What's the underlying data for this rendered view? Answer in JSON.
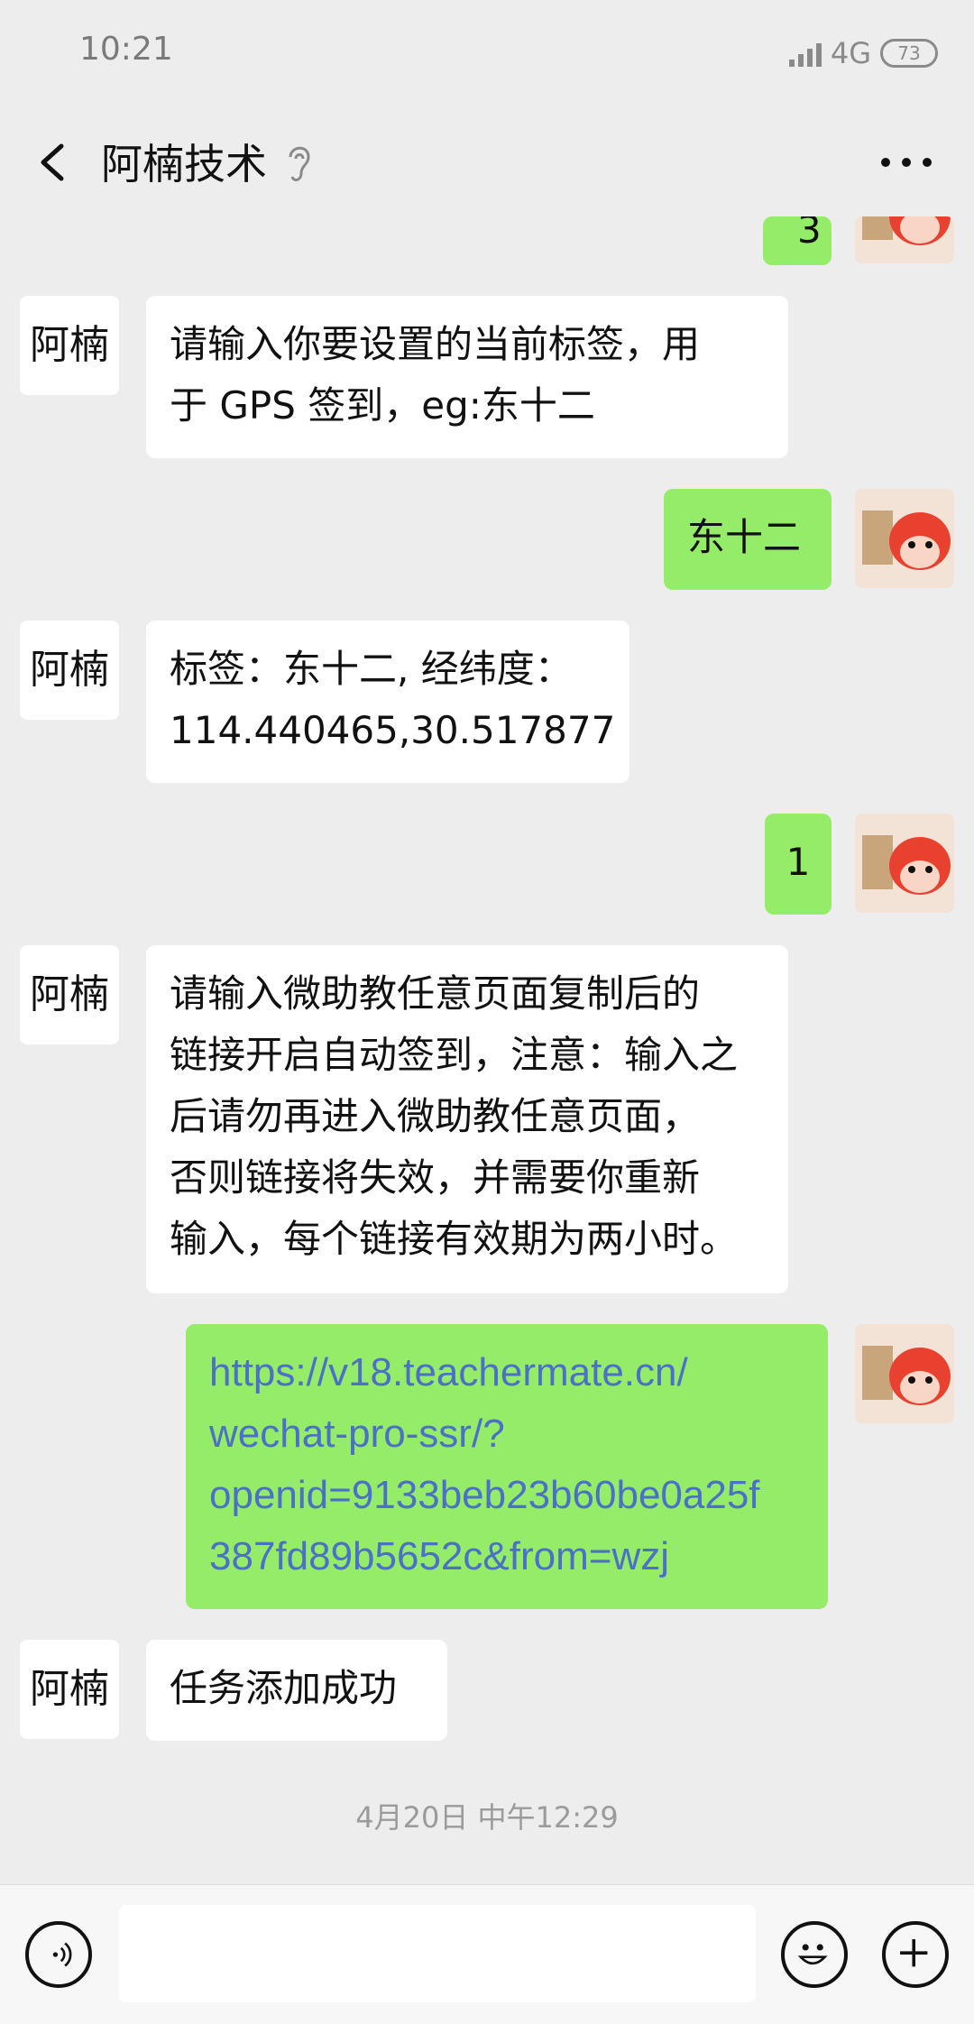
{
  "status": {
    "time": "10:21",
    "network": "4G",
    "battery": "73"
  },
  "header": {
    "title": "阿楠技术"
  },
  "messages": {
    "partial_right": "3",
    "m1": "请输入你要设置的当前标签，用\n于 GPS 签到，eg:东十二",
    "m2": "东十二",
    "m3": "标签：东十二, 经纬度：\n114.440465,30.517877",
    "m4": "1",
    "m5": "请输入微助教任意页面复制后的\n链接开启自动签到，注意：输入之\n后请勿再进入微助教任意页面，\n否则链接将失效，并需要你重新\n输入，每个链接有效期为两小时。",
    "m6": "https://v18.teachermate.cn/\nwechat-pro-ssr/?\nopenid=9133beb23b60be0a25f\n387fd89b5652c&from=wzj",
    "m7": "任务添加成功"
  },
  "bot_avatar": "阿楠",
  "timestamp": "4月20日 中午12:29",
  "icons": {
    "back": "back-arrow-icon",
    "ear": "ear-icon",
    "more": "more-icon",
    "voice": "voice-icon",
    "emoji": "emoji-icon",
    "add": "add-icon"
  }
}
